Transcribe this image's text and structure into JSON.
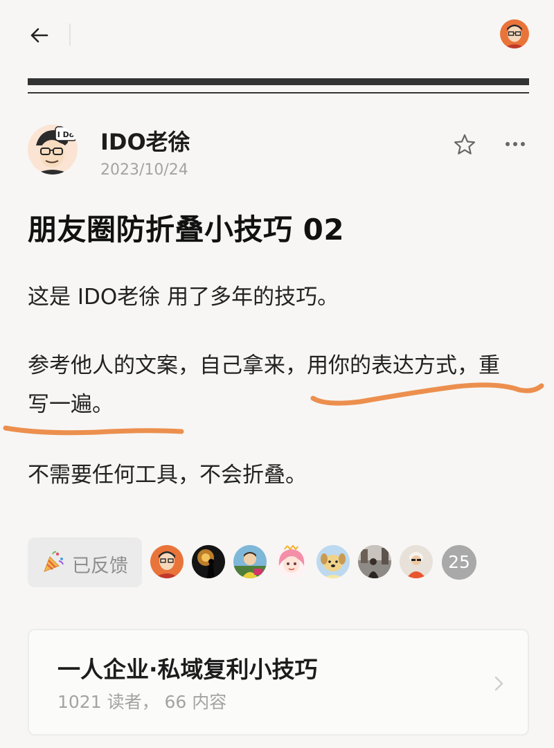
{
  "header": {
    "back_icon": "arrow-left-icon",
    "user_avatar_icon": "user-avatar-cartoon"
  },
  "post": {
    "author": "IDO老徐",
    "date": "2023/10/24",
    "title": "朋友圈防折叠小技巧 02",
    "paragraphs": [
      "这是 IDO老徐 用了多年的技巧。",
      "参考他人的文案，自己拿来，用你的表达方式，重",
      "写一遍。",
      "不需要任何工具，不会折叠。"
    ],
    "avatar_badge_text": "I Do",
    "star_icon": "star-outline-icon",
    "more_icon": "more-horizontal-icon"
  },
  "annotation": {
    "underline_color": "#ec8f4e"
  },
  "feedback": {
    "label": "已反馈",
    "icon": "party-popper-icon",
    "reactor_avatars": [
      "cartoon-man-glasses",
      "silhouette-sunset",
      "child-photo",
      "anime-pink-hair",
      "cartoon-dog",
      "street-photo",
      "person-orange-scarf"
    ],
    "count": "25"
  },
  "series": {
    "title": "一人企业·私域复利小技巧",
    "meta": "1021 读者， 66 内容",
    "chevron_icon": "chevron-right-icon"
  },
  "colors": {
    "background": "#f7f6f4",
    "text": "#1a1a1a",
    "muted": "#a3a3a3",
    "rule": "#333333",
    "accent_orange": "#ec8f4e"
  }
}
